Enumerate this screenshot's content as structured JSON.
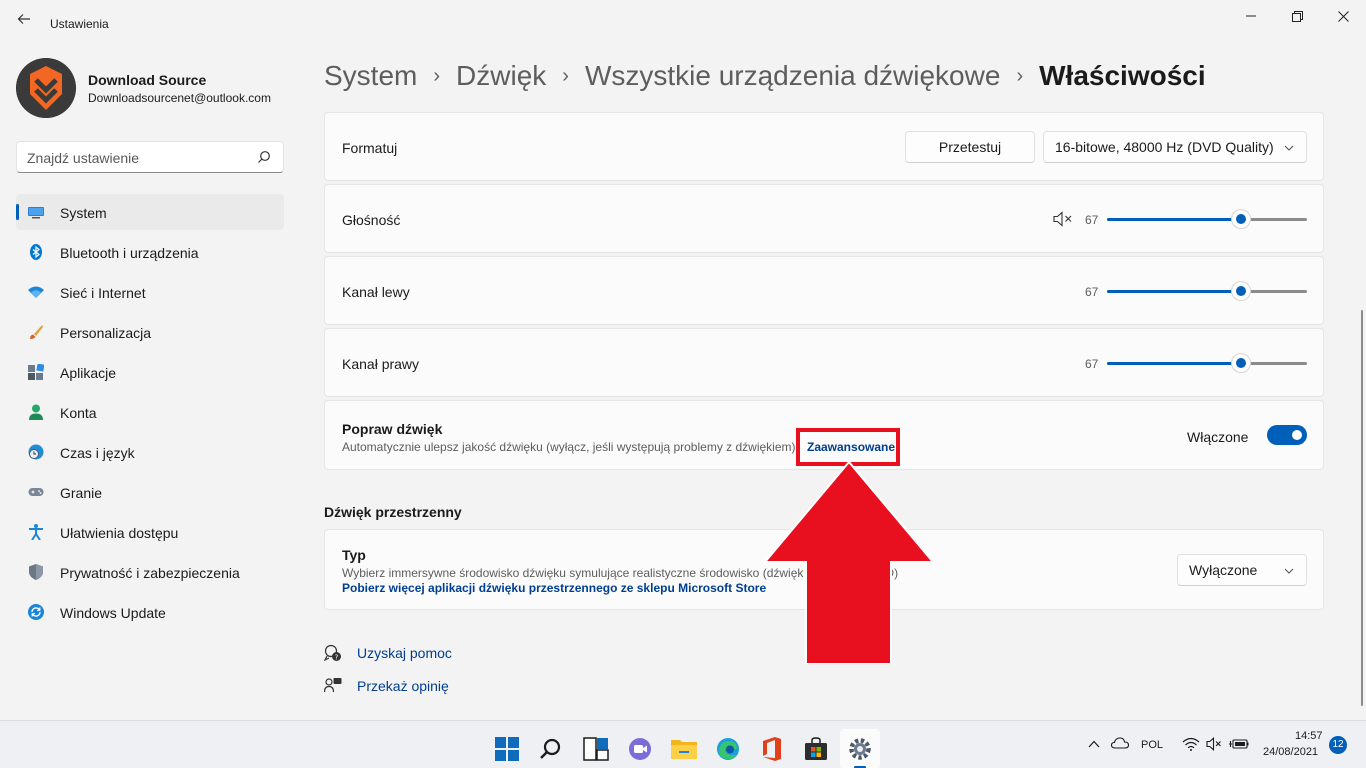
{
  "window": {
    "title": "Ustawienia",
    "minimize": "—",
    "maximize": "❐",
    "close": "✕"
  },
  "user": {
    "name": "Download Source",
    "email": "Downloadsourcenet@outlook.com"
  },
  "search": {
    "placeholder": "Znajdź ustawienie"
  },
  "sidebar": {
    "items": [
      {
        "label": "System",
        "icon": "display-icon",
        "active": true
      },
      {
        "label": "Bluetooth i urządzenia",
        "icon": "bluetooth-icon"
      },
      {
        "label": "Sieć i Internet",
        "icon": "wifi-icon"
      },
      {
        "label": "Personalizacja",
        "icon": "brush-icon"
      },
      {
        "label": "Aplikacje",
        "icon": "apps-icon"
      },
      {
        "label": "Konta",
        "icon": "person-icon"
      },
      {
        "label": "Czas i język",
        "icon": "globe-clock-icon"
      },
      {
        "label": "Granie",
        "icon": "gamepad-icon"
      },
      {
        "label": "Ułatwienia dostępu",
        "icon": "accessibility-icon"
      },
      {
        "label": "Prywatność i zabezpieczenia",
        "icon": "shield-icon"
      },
      {
        "label": "Windows Update",
        "icon": "update-icon"
      }
    ]
  },
  "breadcrumb": {
    "items": [
      "System",
      "Dźwięk",
      "Wszystkie urządzenia dźwiękowe"
    ],
    "separator": "›",
    "current": "Właściwości"
  },
  "format": {
    "label": "Formatuj",
    "test_button": "Przetestuj",
    "selected": "16-bitowe, 48000 Hz (DVD Quality)"
  },
  "volume": {
    "label": "Głośność",
    "value": "67",
    "level": 0.67
  },
  "left_channel": {
    "label": "Kanał lewy",
    "value": "67",
    "level": 0.67
  },
  "right_channel": {
    "label": "Kanał prawy",
    "value": "67",
    "level": 0.67
  },
  "enhance": {
    "title": "Popraw dźwięk",
    "description": "Automatycznie ulepsz jakość dźwięku (wyłącz, jeśli występują problemy z dźwiękiem)",
    "advanced_link": "Zaawansowane",
    "state_label": "Włączone",
    "on": true
  },
  "spatial": {
    "section_title": "Dźwięk przestrzenny",
    "type_title": "Typ",
    "description": "Wybierz immersywne środowisko dźwięku symulujące realistyczne środowisko (dźwięk przestrzenny 3D)",
    "store_link": "Pobierz więcej aplikacji dźwięku przestrzennego ze sklepu Microsoft Store",
    "selected": "Wyłączone"
  },
  "help": {
    "get_help": "Uzyskaj pomoc",
    "feedback": "Przekaż opinię"
  },
  "taskbar": {
    "apps": [
      "start-icon",
      "search-icon",
      "task-view-icon",
      "chat-icon",
      "file-explorer-icon",
      "edge-icon",
      "office-icon",
      "store-icon",
      "settings-icon"
    ],
    "language": "POL",
    "time": "14:57",
    "date": "24/08/2021",
    "notifications": "12"
  },
  "colors": {
    "accent": "#005fb8",
    "annotation": "#e8101f"
  }
}
